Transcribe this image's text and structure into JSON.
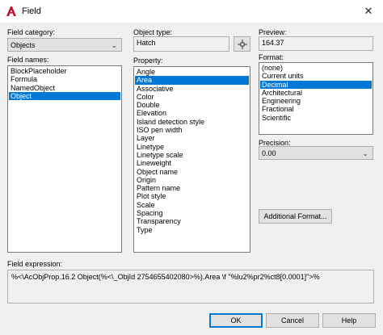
{
  "window": {
    "title": "Field"
  },
  "labels": {
    "field_category": "Field category:",
    "field_names": "Field names:",
    "object_type": "Object type:",
    "property": "Property:",
    "preview": "Preview:",
    "format": "Format:",
    "precision": "Precision:",
    "field_expression": "Field expression:"
  },
  "field_category": {
    "value": "Objects"
  },
  "field_names": {
    "items": [
      "BlockPlaceholder",
      "Formula",
      "NamedObject",
      "Object"
    ],
    "selected": "Object"
  },
  "object_type": {
    "value": "Hatch"
  },
  "property": {
    "items": [
      "Angle",
      "Area",
      "Associative",
      "Color",
      "Double",
      "Elevation",
      "Island detection style",
      "ISO pen width",
      "Layer",
      "Linetype",
      "Linetype scale",
      "Lineweight",
      "Object name",
      "Origin",
      "Pattern name",
      "Plot style",
      "Scale",
      "Spacing",
      "Transparency",
      "Type"
    ],
    "selected": "Area"
  },
  "preview": {
    "value": "164.37"
  },
  "format": {
    "items": [
      "(none)",
      "Current units",
      "Decimal",
      "Architectural",
      "Engineering",
      "Fractional",
      "Scientific"
    ],
    "selected": "Decimal"
  },
  "precision": {
    "value": "0.00"
  },
  "buttons": {
    "additional_format": "Additional Format...",
    "ok": "OK",
    "cancel": "Cancel",
    "help": "Help"
  },
  "field_expression": {
    "value": "%<\\AcObjProp.16.2 Object(%<\\_ObjId 2754655402080>%).Area \\f \"%lu2%pr2%ct8[0.0001]\">%"
  },
  "icons": {
    "app": "autocad-icon",
    "close": "close-icon",
    "pick": "pick-object-icon",
    "dropdown": "chevron-down-icon"
  }
}
